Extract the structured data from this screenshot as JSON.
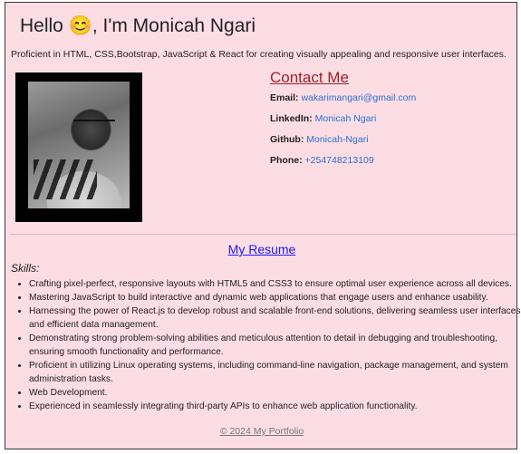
{
  "header": {
    "greeting": "Hello 😊, I'm Monicah Ngari",
    "intro": "Proficient in HTML, CSS,Bootstrap, JavaScript & React for creating visually appealing and responsive user interfaces."
  },
  "contact": {
    "title": "Contact Me",
    "items": [
      {
        "label": "Email:",
        "value": "wakarimangari@gmail.com"
      },
      {
        "label": "LinkedIn:",
        "value": "Monicah Ngari"
      },
      {
        "label": "Github:",
        "value": "Monicah-Ngari"
      },
      {
        "label": "Phone:",
        "value": "+254748213109"
      }
    ]
  },
  "resume": {
    "link_label": "My Resume",
    "skills_title": "Skills:",
    "skills": [
      "Crafting pixel-perfect, responsive layouts with HTML5 and CSS3 to ensure optimal user experience across all devices.",
      "Mastering JavaScript to build interactive and dynamic web applications that engage users and enhance usability.",
      "Harnessing the power of React.js to develop robust and scalable front-end solutions, delivering seamless user interfaces and efficient data management.",
      "Demonstrating strong problem-solving abilities and meticulous attention to detail in debugging and troubleshooting, ensuring smooth functionality and performance.",
      "Proficient in utilizing Linux operating systems, including command-line navigation, package management, and system administration tasks.",
      "Web Development.",
      "Experienced in seamlessly integrating third-party APIs to enhance web application functionality."
    ]
  },
  "footer": {
    "text": "© 2024 My Portfolio"
  }
}
